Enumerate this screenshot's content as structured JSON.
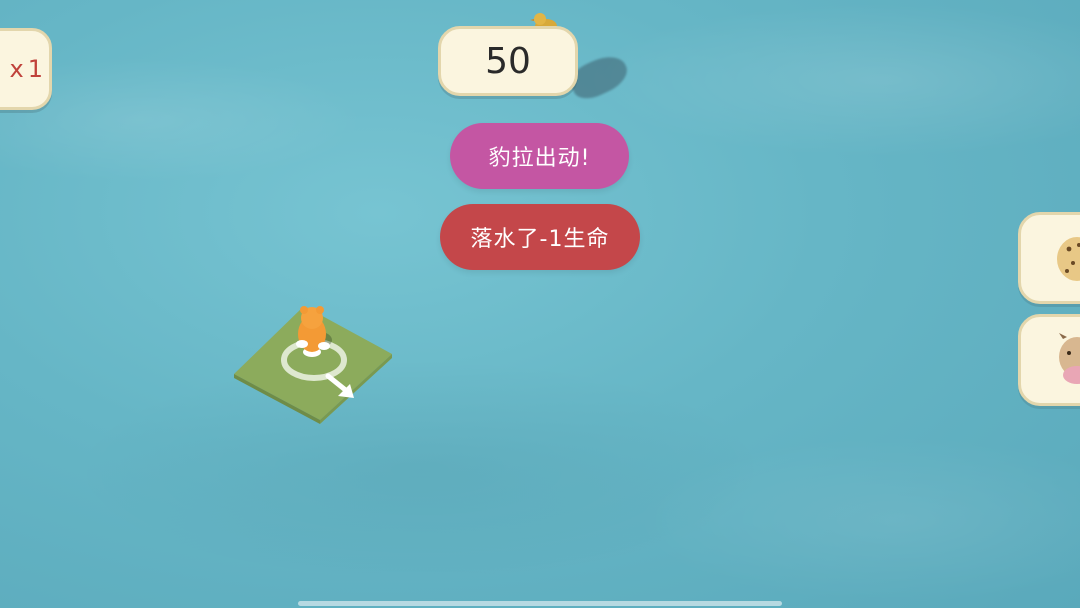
{
  "hud": {
    "score": "50",
    "left_counter": "1",
    "left_counter_partial_glyph": "x"
  },
  "messages": {
    "character_dispatch": "豹拉出动!",
    "fell_in_water": "落水了-1生命"
  },
  "side_cards": [
    {
      "icon": "leopard-icon"
    },
    {
      "icon": "cow-icon"
    }
  ],
  "player": {
    "character": "orange-bear",
    "tile_color": "#8cab5c",
    "direction_arrow": "down-right"
  },
  "colors": {
    "water": "#66b6c6",
    "pill_bg": "#fbf5df",
    "pill_border": "#e3d6ac",
    "purple_toast": "#c456a3",
    "red_toast": "#c4474a",
    "counter_text": "#c0423b"
  }
}
